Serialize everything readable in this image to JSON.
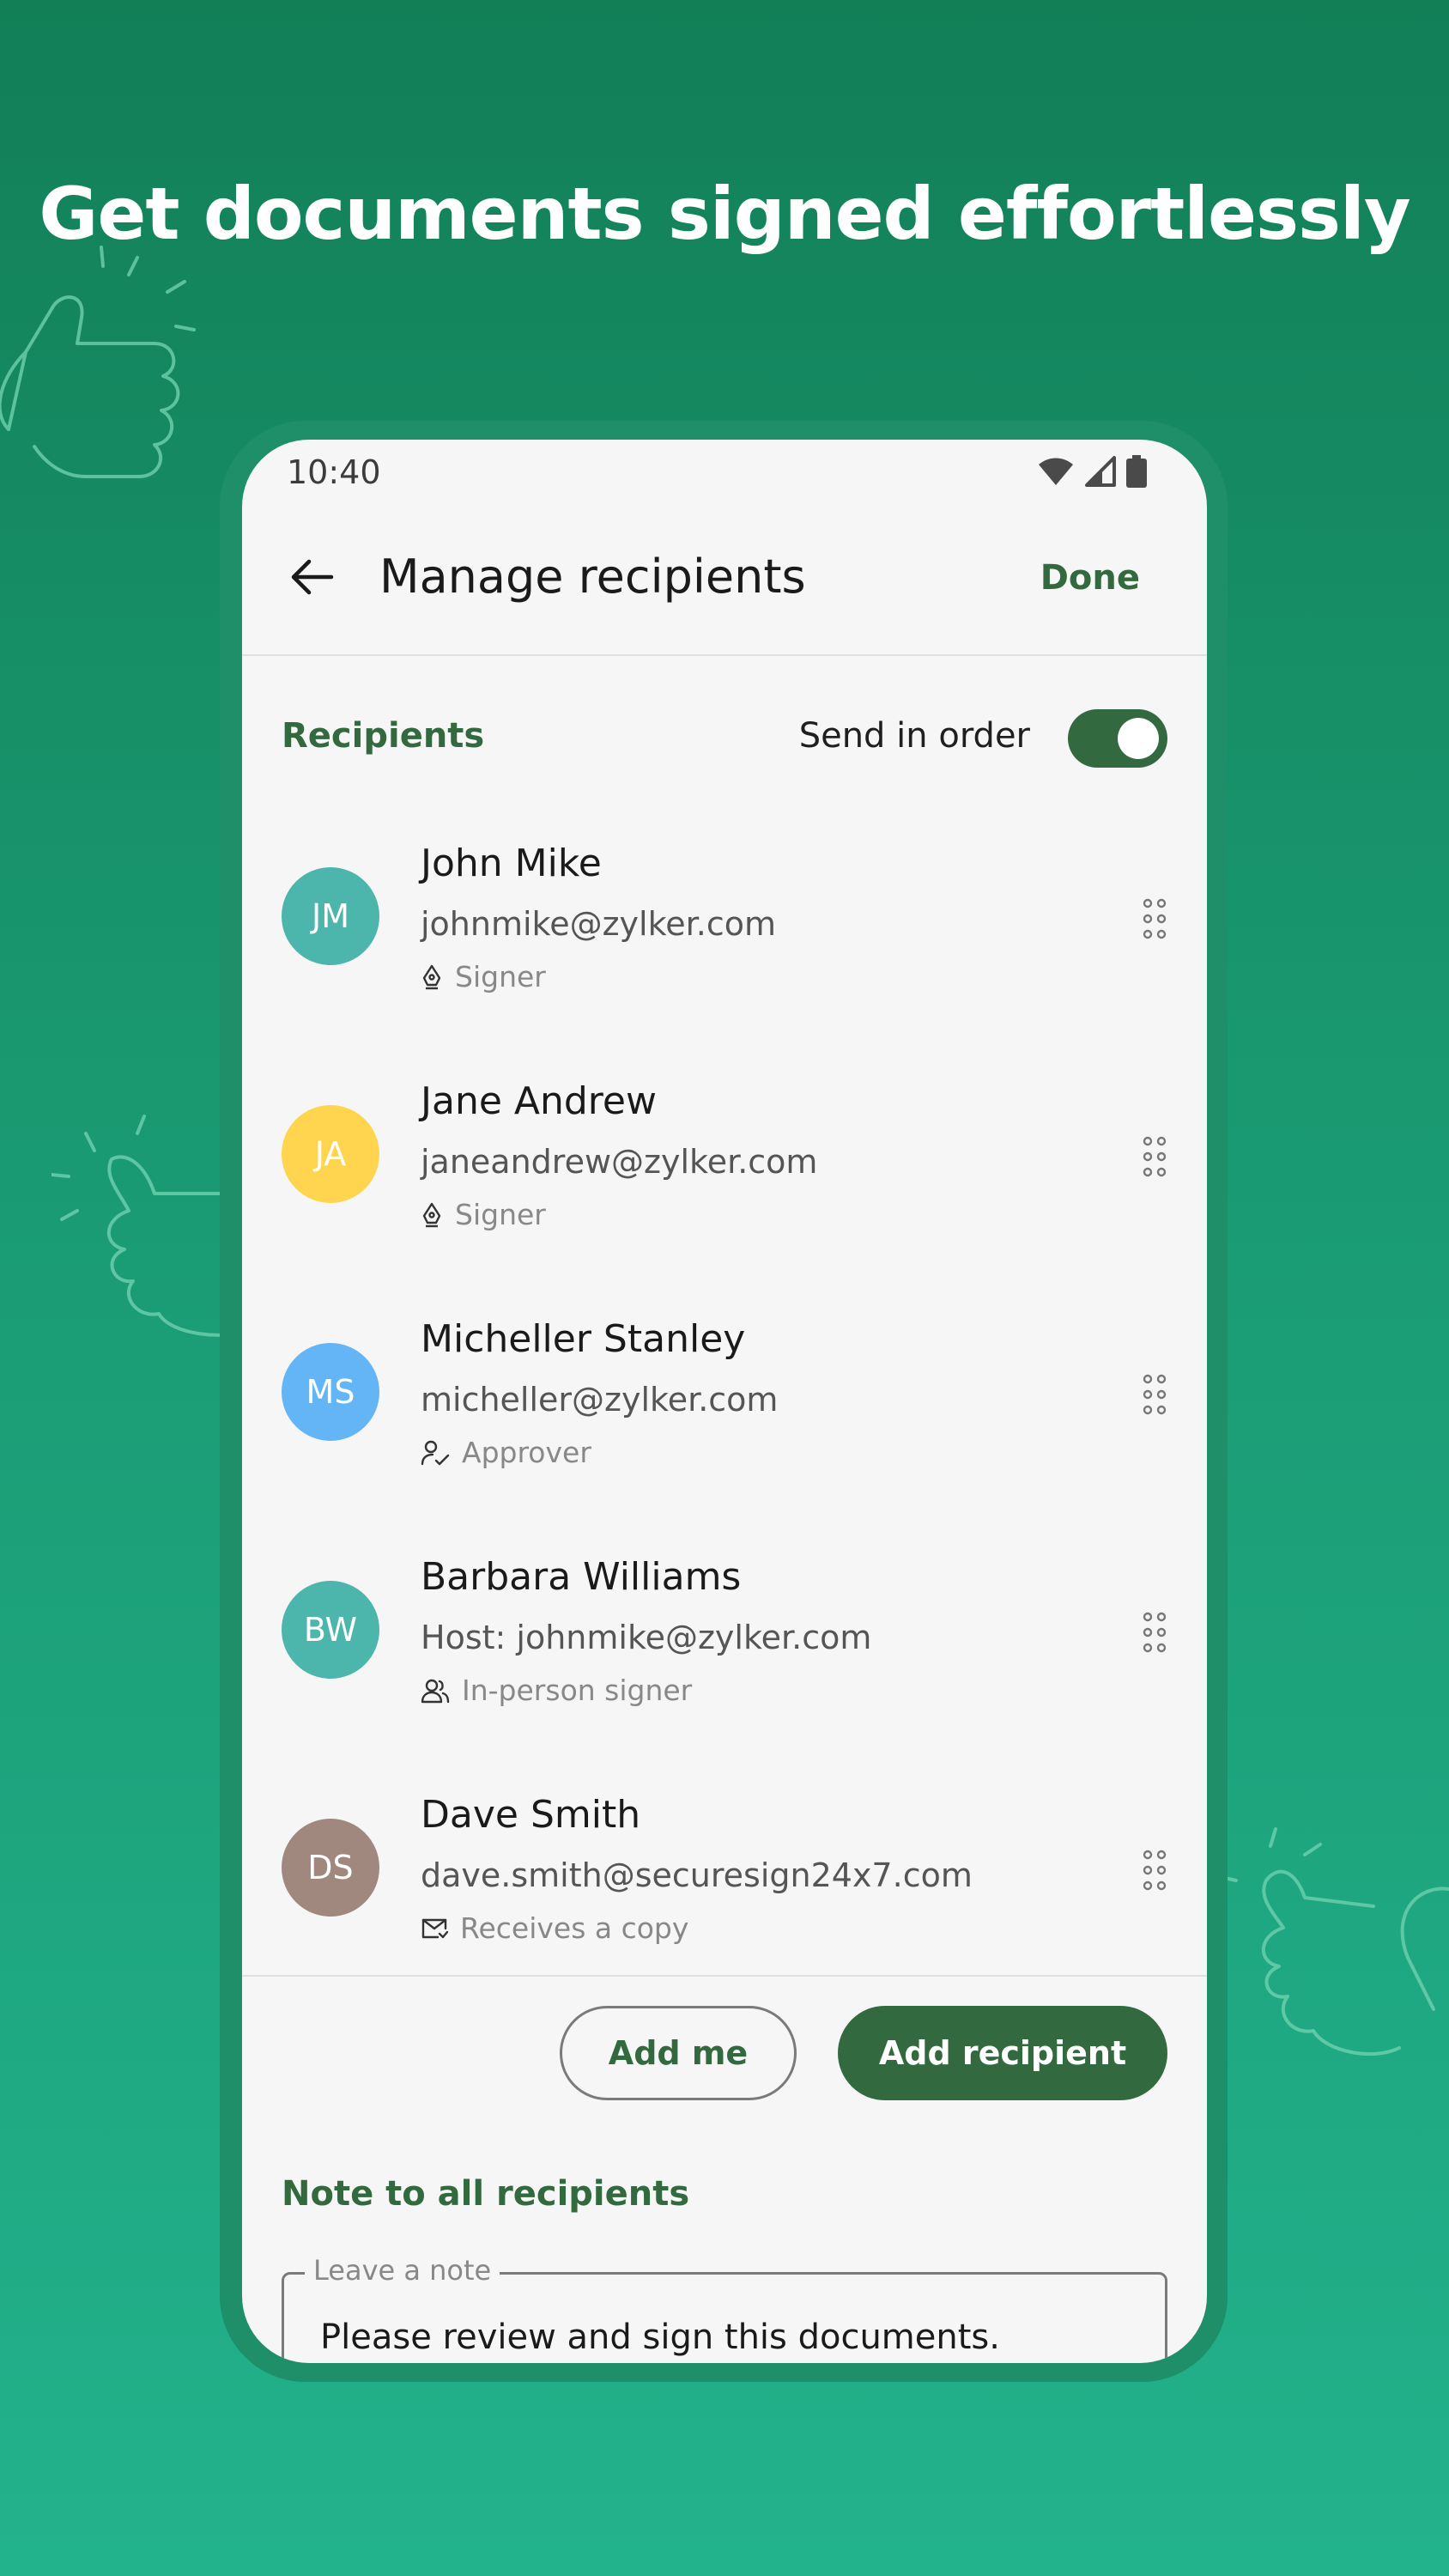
{
  "headline": "Get documents signed effortlessly",
  "status_bar": {
    "time": "10:40"
  },
  "app_bar": {
    "title": "Manage recipients",
    "done_label": "Done"
  },
  "recipients_section": {
    "label": "Recipients",
    "send_in_order_label": "Send in order",
    "send_in_order_enabled": true
  },
  "recipients": [
    {
      "initials": "JM",
      "name": "John Mike",
      "email": "johnmike@zylker.com",
      "role": "Signer",
      "role_icon": "pen-nib-icon",
      "color": "#4db6ac"
    },
    {
      "initials": "JA",
      "name": "Jane Andrew",
      "email": "janeandrew@zylker.com",
      "role": "Signer",
      "role_icon": "pen-nib-icon",
      "color": "#ffd54f"
    },
    {
      "initials": "MS",
      "name": "Micheller Stanley",
      "email": "micheller@zylker.com",
      "role": "Approver",
      "role_icon": "person-check-icon",
      "color": "#64b5f6"
    },
    {
      "initials": "BW",
      "name": "Barbara Williams",
      "email": "Host: johnmike@zylker.com",
      "role": "In-person signer",
      "role_icon": "people-icon",
      "color": "#4db6ac"
    },
    {
      "initials": "DS",
      "name": "Dave Smith",
      "email": "dave.smith@securesign24x7.com",
      "role": "Receives a copy",
      "role_icon": "mail-copy-icon",
      "color": "#a1887f"
    }
  ],
  "actions": {
    "add_me_label": "Add me",
    "add_recipient_label": "Add recipient"
  },
  "note": {
    "section_label": "Note to all recipients",
    "field_label": "Leave a note",
    "value": "Please review and sign this documents."
  },
  "colors": {
    "brand_green": "#33693f",
    "background_top": "#127f57",
    "background_bottom": "#22b28c"
  }
}
